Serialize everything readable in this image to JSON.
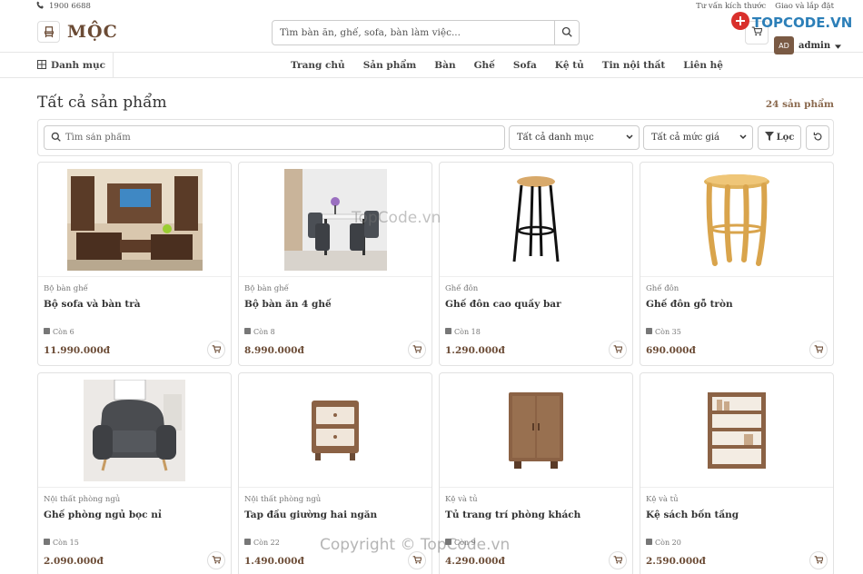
{
  "topbar": {
    "phone": "1900 6688",
    "links": [
      "Tư vấn kích thước",
      "Giao và lắp đặt"
    ]
  },
  "brand": {
    "name": "MỘC"
  },
  "search": {
    "placeholder": "Tìm bàn ăn, ghế, sofa, bàn làm việc..."
  },
  "user": {
    "avatar": "AD",
    "name": "admin"
  },
  "nav": {
    "category_label": "Danh mục",
    "links": [
      "Trang chủ",
      "Sản phẩm",
      "Bàn",
      "Ghế",
      "Sofa",
      "Kệ tủ",
      "Tin nội thất",
      "Liên hệ"
    ]
  },
  "page": {
    "title": "Tất cả sản phẩm",
    "count": "24 sản phẩm"
  },
  "filters": {
    "search_placeholder": "Tìm sản phẩm",
    "category_select": "Tất cả danh mục",
    "price_select": "Tất cả mức giá",
    "filter_label": "Lọc"
  },
  "products": [
    {
      "category": "Bộ bàn ghế",
      "name": "Bộ sofa và bàn trà",
      "stock": "Còn 6",
      "price": "11.990.000đ",
      "image": "living-room-photo"
    },
    {
      "category": "Bộ bàn ghế",
      "name": "Bộ bàn ăn 4 ghế",
      "stock": "Còn 8",
      "price": "8.990.000đ",
      "image": "dining-set-photo"
    },
    {
      "category": "Ghế đôn",
      "name": "Ghế đôn cao quầy bar",
      "stock": "Còn 18",
      "price": "1.290.000đ",
      "image": "bar-stool-photo"
    },
    {
      "category": "Ghế đôn",
      "name": "Ghế đôn gỗ tròn",
      "stock": "Còn 35",
      "price": "690.000đ",
      "image": "wood-stool-photo"
    },
    {
      "category": "Nội thất phòng ngủ",
      "name": "Ghế phòng ngủ bọc nỉ",
      "stock": "Còn 15",
      "price": "2.090.000đ",
      "image": "armchair-photo"
    },
    {
      "category": "Nội thất phòng ngủ",
      "name": "Tap đầu giường hai ngăn",
      "stock": "Còn 22",
      "price": "1.490.000đ",
      "image": "nightstand-icon"
    },
    {
      "category": "Kệ và tủ",
      "name": "Tủ trang trí phòng khách",
      "stock": "Còn 9",
      "price": "4.290.000đ",
      "image": "cabinet-icon"
    },
    {
      "category": "Kệ và tủ",
      "name": "Kệ sách bốn tầng",
      "stock": "Còn 20",
      "price": "2.590.000đ",
      "image": "bookshelf-icon"
    }
  ],
  "watermark": {
    "logo": "TOPCODE.VN",
    "center": "TopCode.vn",
    "copyright": "Copyright © TopCode.vn"
  }
}
